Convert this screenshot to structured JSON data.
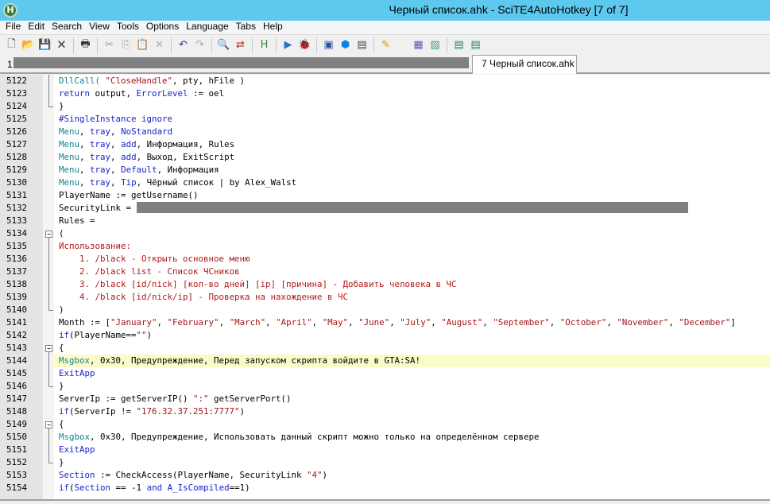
{
  "window": {
    "title": "Черный список.ahk - SciTE4AutoHotkey [7 of 7]",
    "app_icon": "H"
  },
  "menu": [
    "File",
    "Edit",
    "Search",
    "View",
    "Tools",
    "Options",
    "Language",
    "Tabs",
    "Help"
  ],
  "toolbar": [
    [
      "new-file-icon",
      "🗋"
    ],
    [
      "open-folder-icon",
      "📂"
    ],
    [
      "save-icon",
      "💾"
    ],
    [
      "close-file-icon",
      "🗙"
    ],
    "|",
    [
      "print-icon",
      "🖶"
    ],
    "|",
    [
      "cut-icon",
      "✂"
    ],
    [
      "copy-icon",
      "⎘"
    ],
    [
      "paste-icon",
      "📋"
    ],
    [
      "delete-icon",
      "✕"
    ],
    "|",
    [
      "undo-icon",
      "↶"
    ],
    [
      "redo-icon",
      "↷"
    ],
    "|",
    [
      "find-icon",
      "🔍"
    ],
    [
      "replace-icon",
      "⇄"
    ],
    "|",
    [
      "ahk-help-icon",
      "H"
    ],
    "|",
    [
      "run-icon",
      "▶"
    ],
    [
      "debug-icon",
      "🐞"
    ],
    "|",
    [
      "window-spy-icon",
      "▣"
    ],
    [
      "compile-icon",
      "⬢"
    ],
    [
      "toolbox-icon",
      "▤"
    ],
    "|",
    [
      "edit-icon",
      "✎"
    ],
    [
      "properties-icon",
      "▦"
    ],
    [
      "settings-icon",
      "▧"
    ],
    "|",
    [
      "tools-icon-a",
      "▤"
    ],
    [
      "tools-icon-b",
      "▤"
    ]
  ],
  "tabs": {
    "first_label": "1",
    "active_label": "7 Черный список.ahk"
  },
  "colors": {
    "keyword": "#1a22cc",
    "command": "#17808f",
    "string": "#a31515",
    "highlight": "#fbfbc8",
    "titlebar": "#5ec9ef"
  },
  "editor": {
    "highlight_line": 5144,
    "lines": [
      {
        "n": "5122",
        "f": "v",
        "tk": [
          [
            "DllCall( ",
            "c"
          ],
          [
            "\"CloseHandle\"",
            "s"
          ],
          [
            ", pty, hFile )",
            ""
          ]
        ]
      },
      {
        "n": "5123",
        "f": "v",
        "tk": [
          [
            "return",
            "k"
          ],
          [
            " output, ",
            ""
          ],
          [
            "ErrorLevel",
            "k"
          ],
          [
            " := oel",
            ""
          ]
        ]
      },
      {
        "n": "5124",
        "f": "e",
        "tk": [
          [
            "}",
            ""
          ]
        ]
      },
      {
        "n": "5125",
        "f": "",
        "tk": [
          [
            "#SingleInstance ignore",
            "k"
          ]
        ]
      },
      {
        "n": "5126",
        "f": "",
        "tk": [
          [
            "Menu",
            "c"
          ],
          [
            ", ",
            ""
          ],
          [
            "tray",
            "k"
          ],
          [
            ", ",
            ""
          ],
          [
            "NoStandard",
            "k"
          ]
        ]
      },
      {
        "n": "5127",
        "f": "",
        "tk": [
          [
            "Menu",
            "c"
          ],
          [
            ", ",
            ""
          ],
          [
            "tray",
            "k"
          ],
          [
            ", ",
            ""
          ],
          [
            "add",
            "k"
          ],
          [
            ", Информация, Rules",
            ""
          ]
        ]
      },
      {
        "n": "5128",
        "f": "",
        "tk": [
          [
            "Menu",
            "c"
          ],
          [
            ", ",
            ""
          ],
          [
            "tray",
            "k"
          ],
          [
            ", ",
            ""
          ],
          [
            "add",
            "k"
          ],
          [
            ", Выход, ExitScript",
            ""
          ]
        ]
      },
      {
        "n": "5129",
        "f": "",
        "tk": [
          [
            "Menu",
            "c"
          ],
          [
            ", ",
            ""
          ],
          [
            "tray",
            "k"
          ],
          [
            ", ",
            ""
          ],
          [
            "Default",
            "k"
          ],
          [
            ", Информация",
            ""
          ]
        ]
      },
      {
        "n": "5130",
        "f": "",
        "tk": [
          [
            "Menu",
            "c"
          ],
          [
            ", ",
            ""
          ],
          [
            "tray",
            "k"
          ],
          [
            ", ",
            ""
          ],
          [
            "Tip",
            "k"
          ],
          [
            ", Чёрный список | by Alex_Walst",
            ""
          ]
        ]
      },
      {
        "n": "5131",
        "f": "",
        "tk": [
          [
            "PlayerName := getUsername()",
            ""
          ]
        ]
      },
      {
        "n": "5132",
        "f": "",
        "tk": [
          [
            "SecurityLink = ",
            ""
          ]
        ],
        "redact": true
      },
      {
        "n": "5133",
        "f": "",
        "tk": [
          [
            "Rules =",
            ""
          ]
        ]
      },
      {
        "n": "5134",
        "f": "b",
        "tk": [
          [
            "(",
            ""
          ]
        ]
      },
      {
        "n": "5135",
        "f": "v",
        "tk": [
          [
            "Использование:",
            "t"
          ]
        ]
      },
      {
        "n": "5136",
        "f": "v",
        "tk": [
          [
            "    1. /black - Открыть основное меню",
            "t"
          ]
        ]
      },
      {
        "n": "5137",
        "f": "v",
        "tk": [
          [
            "    2. /black list - Список ЧСников",
            "t"
          ]
        ]
      },
      {
        "n": "5138",
        "f": "v",
        "tk": [
          [
            "    3. /black [id/nick] [кол-во дней] [ip] [причина] - Добавить человека в ЧС",
            "t"
          ]
        ]
      },
      {
        "n": "5139",
        "f": "v",
        "tk": [
          [
            "    4. /black [id/nick/ip] - Проверка на нахождение в ЧС",
            "t"
          ]
        ]
      },
      {
        "n": "5140",
        "f": "e",
        "tk": [
          [
            ")",
            ""
          ]
        ]
      },
      {
        "n": "5141",
        "f": "",
        "tk": [
          [
            "Month := [",
            ""
          ],
          [
            "\"January\"",
            "s"
          ],
          [
            ", ",
            ""
          ],
          [
            "\"February\"",
            "s"
          ],
          [
            ", ",
            ""
          ],
          [
            "\"March\"",
            "s"
          ],
          [
            ", ",
            ""
          ],
          [
            "\"April\"",
            "s"
          ],
          [
            ", ",
            ""
          ],
          [
            "\"May\"",
            "s"
          ],
          [
            ", ",
            ""
          ],
          [
            "\"June\"",
            "s"
          ],
          [
            ", ",
            ""
          ],
          [
            "\"July\"",
            "s"
          ],
          [
            ", ",
            ""
          ],
          [
            "\"August\"",
            "s"
          ],
          [
            ", ",
            ""
          ],
          [
            "\"September\"",
            "s"
          ],
          [
            ", ",
            ""
          ],
          [
            "\"October\"",
            "s"
          ],
          [
            ", ",
            ""
          ],
          [
            "\"November\"",
            "s"
          ],
          [
            ", ",
            ""
          ],
          [
            "\"December\"",
            "s"
          ],
          [
            "]",
            ""
          ]
        ]
      },
      {
        "n": "5142",
        "f": "",
        "tk": [
          [
            "if",
            "k"
          ],
          [
            "(PlayerName==",
            ""
          ],
          [
            "\"\"",
            "s"
          ],
          [
            ")",
            ""
          ]
        ]
      },
      {
        "n": "5143",
        "f": "b",
        "tk": [
          [
            "{",
            ""
          ]
        ]
      },
      {
        "n": "5144",
        "f": "v",
        "tk": [
          [
            "Msgbox",
            "c"
          ],
          [
            ", 0x30, Предупреждение, Перед запуском скрипта войдите в GTA:SA!",
            ""
          ]
        ]
      },
      {
        "n": "5145",
        "f": "v",
        "tk": [
          [
            "ExitApp",
            "k"
          ]
        ]
      },
      {
        "n": "5146",
        "f": "e",
        "tk": [
          [
            "}",
            ""
          ]
        ]
      },
      {
        "n": "5147",
        "f": "",
        "tk": [
          [
            "ServerIp := getServerIP() ",
            ""
          ],
          [
            "\":\"",
            "s"
          ],
          [
            " getServerPort()",
            ""
          ]
        ]
      },
      {
        "n": "5148",
        "f": "",
        "tk": [
          [
            "if",
            "k"
          ],
          [
            "(ServerIp != ",
            ""
          ],
          [
            "\"176.32.37.251:7777\"",
            "s"
          ],
          [
            ")",
            ""
          ]
        ]
      },
      {
        "n": "5149",
        "f": "b",
        "tk": [
          [
            "{",
            ""
          ]
        ]
      },
      {
        "n": "5150",
        "f": "v",
        "tk": [
          [
            "Msgbox",
            "c"
          ],
          [
            ", 0x30, Предупреждение, Использовать данный скрипт можно только на определённом сервере",
            ""
          ]
        ]
      },
      {
        "n": "5151",
        "f": "v",
        "tk": [
          [
            "ExitApp",
            "k"
          ]
        ]
      },
      {
        "n": "5152",
        "f": "e",
        "tk": [
          [
            "}",
            ""
          ]
        ]
      },
      {
        "n": "5153",
        "f": "",
        "tk": [
          [
            "Section",
            "k"
          ],
          [
            " := CheckAccess(PlayerName, SecurityLink ",
            ""
          ],
          [
            "\"4\"",
            "s"
          ],
          [
            ")",
            ""
          ]
        ]
      },
      {
        "n": "5154",
        "f": "",
        "tk": [
          [
            "if",
            "k"
          ],
          [
            "(",
            ""
          ],
          [
            "Section",
            "k"
          ],
          [
            " == -1 ",
            ""
          ],
          [
            "and",
            "k"
          ],
          [
            " ",
            ""
          ],
          [
            "A_IsCompiled",
            "k"
          ],
          [
            "==1)",
            ""
          ]
        ]
      }
    ]
  }
}
